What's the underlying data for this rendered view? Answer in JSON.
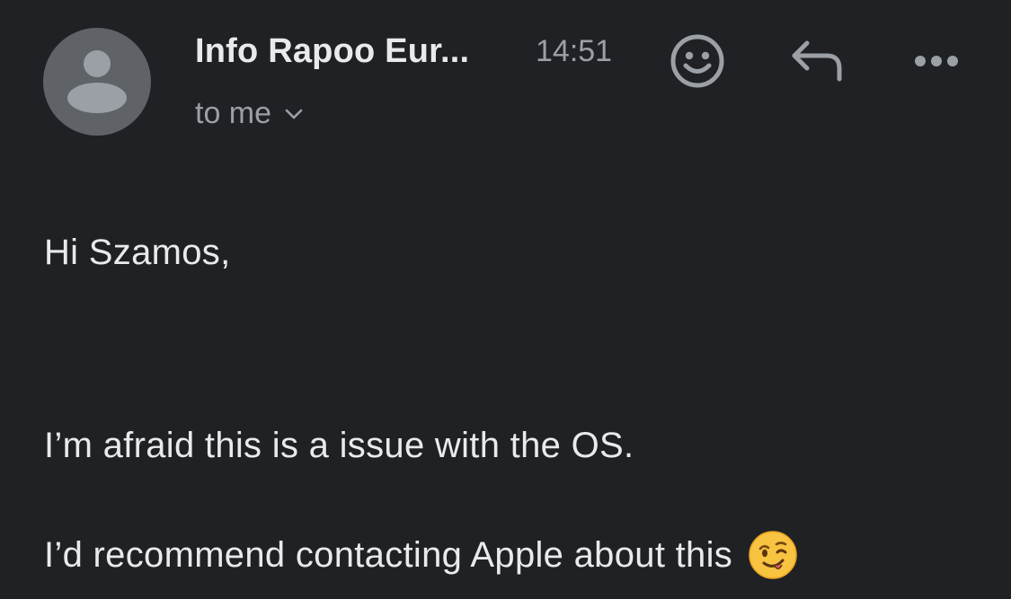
{
  "message": {
    "sender": "Info Rapoo Eur...",
    "time": "14:51",
    "recipient": "to me",
    "greeting": "Hi Szamos,",
    "body_lines": [
      "I’m afraid this is a issue with the OS.",
      "I’d recommend contacting Apple about this"
    ]
  },
  "icons": {
    "avatar": "person-icon",
    "recipient_toggle": "chevron-down-icon",
    "emoji_reaction": "smiley-icon",
    "reply": "reply-icon",
    "more": "more-horizontal-icon",
    "body_emoji": "winking-face-emoji"
  },
  "colors": {
    "background": "#202124",
    "primary_text": "#e8eaed",
    "secondary_text": "#9aa0a6",
    "avatar_bg": "#5f6368"
  }
}
